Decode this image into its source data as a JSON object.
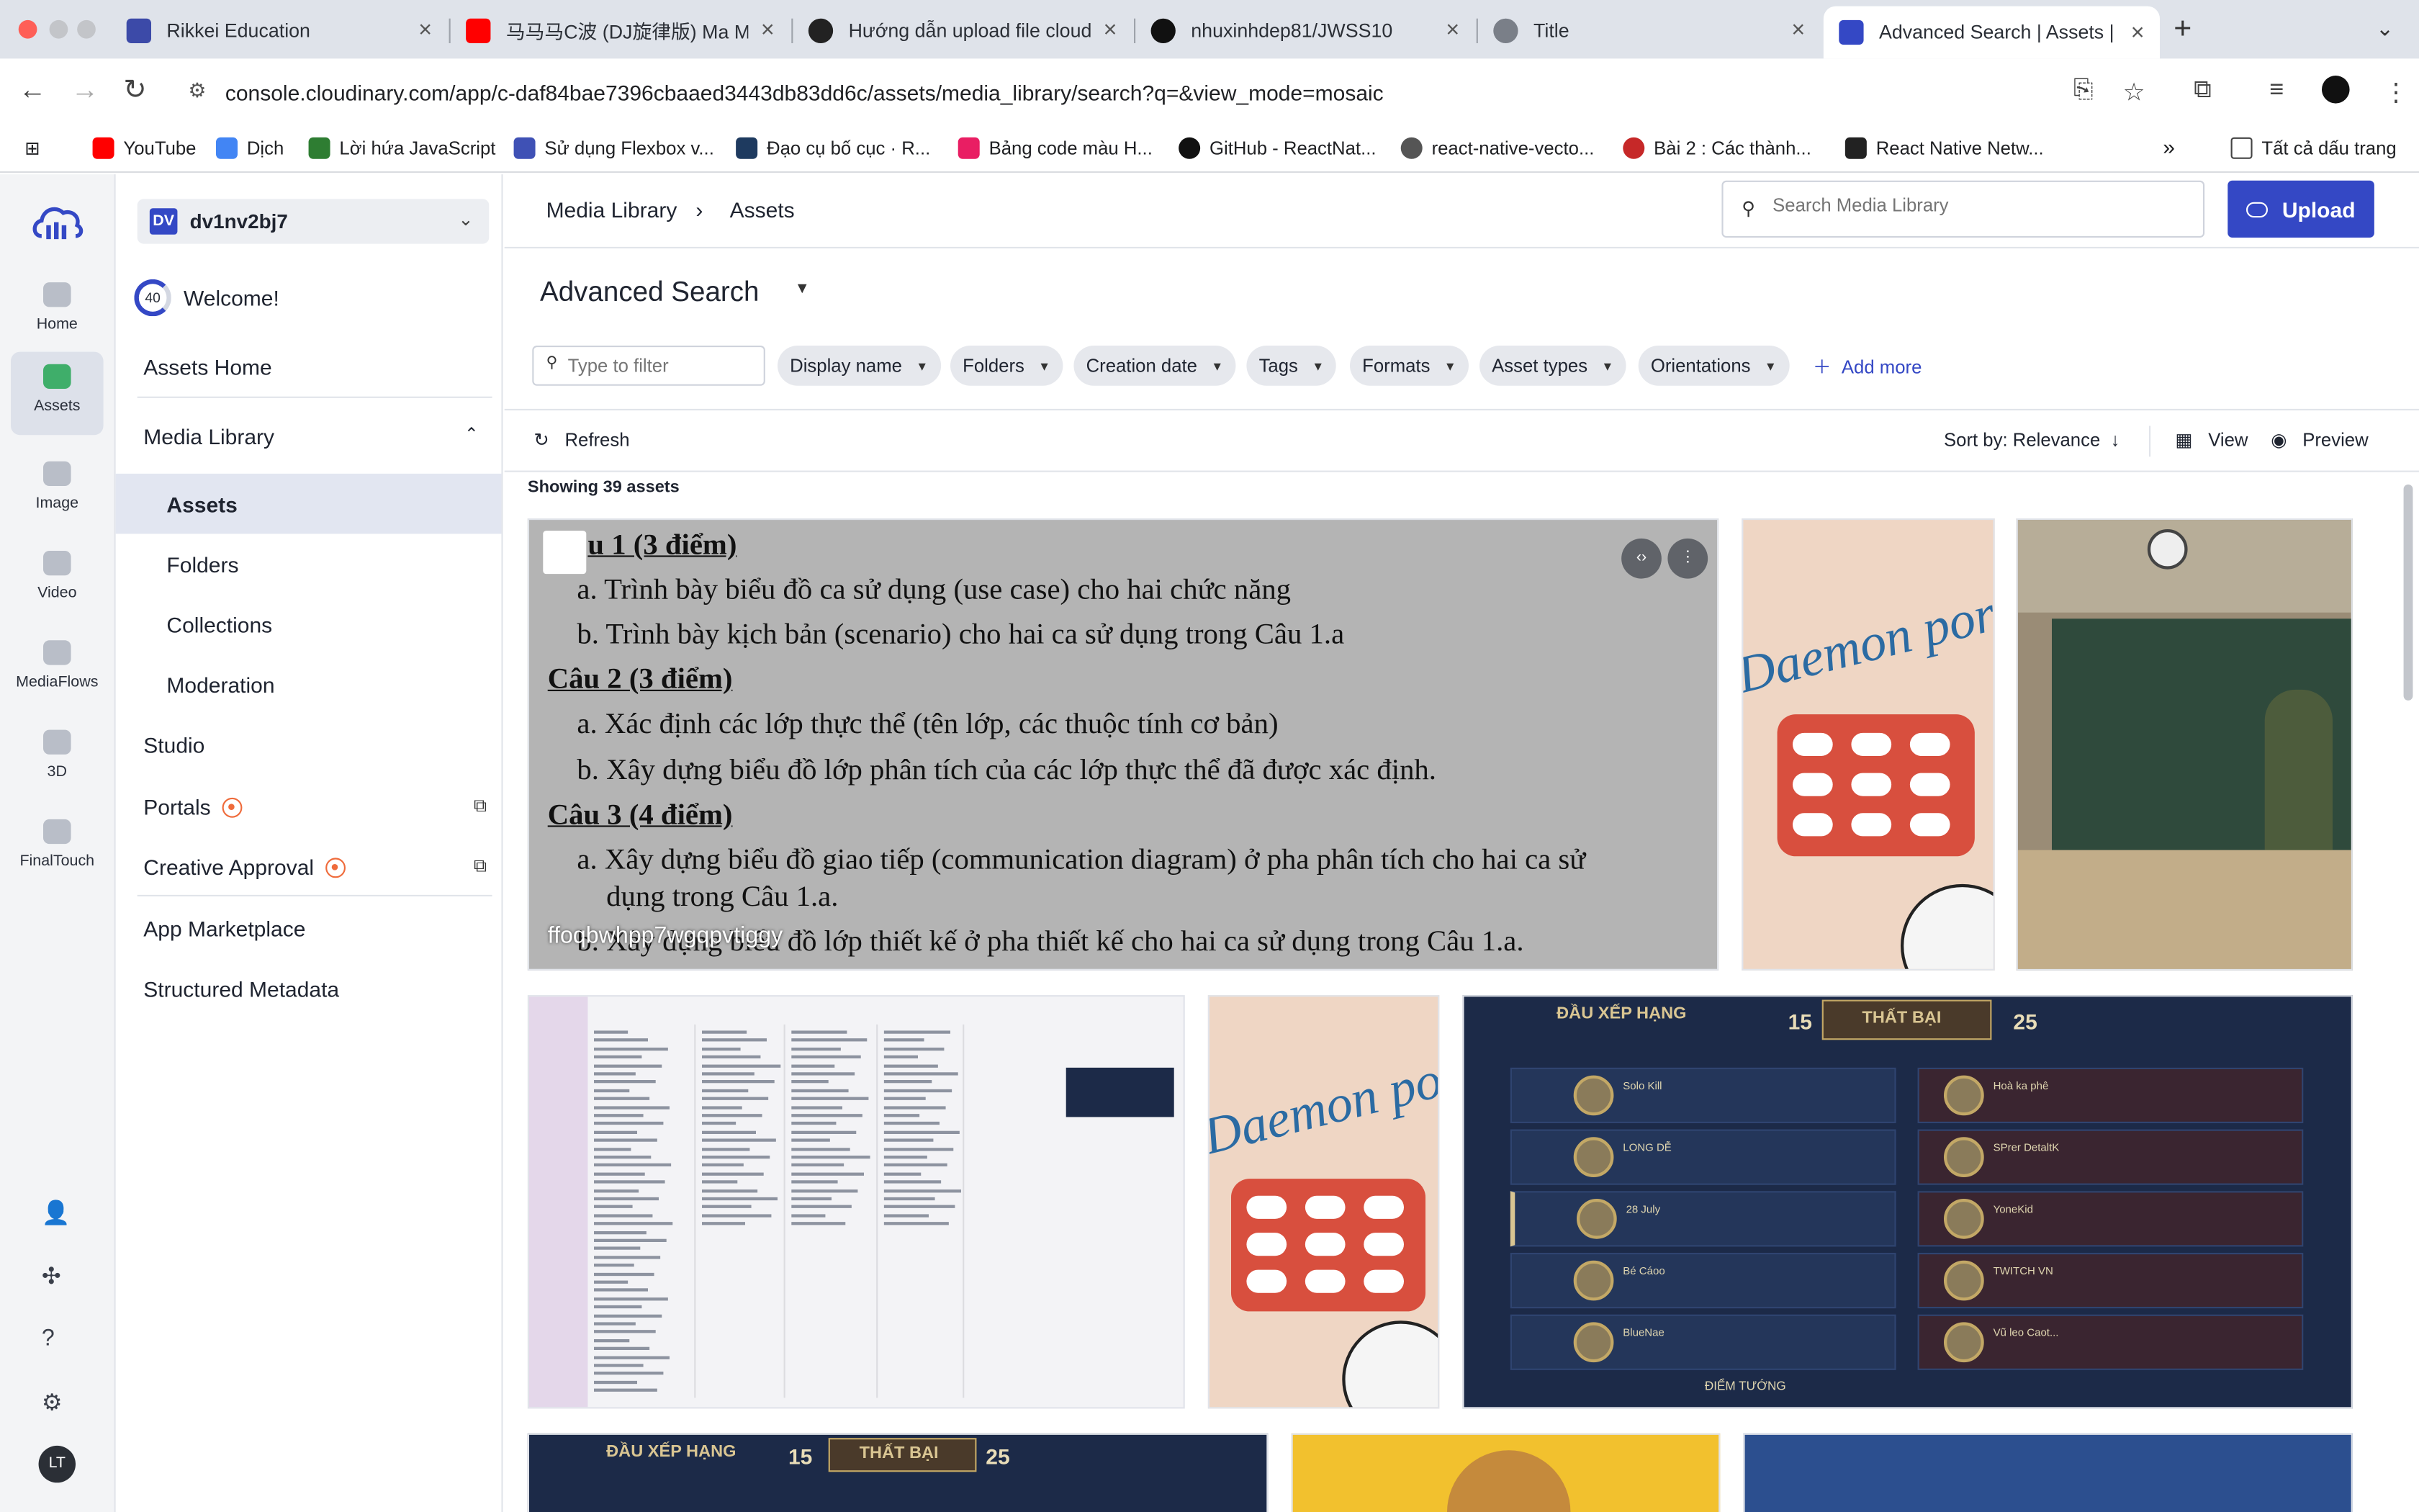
{
  "browser": {
    "tabs": [
      {
        "label": "Rikkei Education",
        "color": "#3c4aa8"
      },
      {
        "label": "马马马C波 (DJ旋律版) Ma Ma C",
        "color": "#ff0000"
      },
      {
        "label": "Hướng dẫn upload file cloud",
        "color": "#222222"
      },
      {
        "label": "nhuxinhdep81/JWSS10",
        "color": "#111111"
      },
      {
        "label": "Title",
        "color": "#7a7f88"
      },
      {
        "label": "Advanced Search | Assets | A",
        "color": "#3448c5"
      }
    ],
    "url": "console.cloudinary.com/app/c-daf84bae7396cbaaed3443db83dd6c/assets/media_library/search?q=&view_mode=mosaic",
    "bookmarks": [
      {
        "label": "YouTube",
        "color": "#ff0000"
      },
      {
        "label": "Dịch",
        "color": "#4285f4"
      },
      {
        "label": "Lời hứa JavaScript",
        "color": "#2e7d32"
      },
      {
        "label": "Sử dụng Flexbox v...",
        "color": "#3f51b5"
      },
      {
        "label": "Đạo cụ bố cục · R...",
        "color": "#1e3a5f"
      },
      {
        "label": "Bảng code màu H...",
        "color": "#e91e63"
      },
      {
        "label": "GitHub - ReactNat...",
        "color": "#111111"
      },
      {
        "label": "react-native-vecto...",
        "color": "#555555"
      },
      {
        "label": "Bài 2 : Các thành...",
        "color": "#c62828"
      },
      {
        "label": "React Native Netw...",
        "color": "#222222"
      }
    ],
    "all_bookmarks": "Tất cả dấu trang"
  },
  "rail": {
    "items": [
      "Home",
      "Assets",
      "Image",
      "Video",
      "MediaFlows",
      "3D",
      "FinalTouch"
    ],
    "avatar": "LT"
  },
  "nav": {
    "cloud_badge": "DV",
    "cloud_name": "dv1nv2bj7",
    "progress": "40",
    "welcome": "Welcome!",
    "assets_home": "Assets Home",
    "media_library": "Media Library",
    "sub": [
      "Assets",
      "Folders",
      "Collections",
      "Moderation"
    ],
    "studio": "Studio",
    "portals": "Portals",
    "creative_approval": "Creative Approval",
    "app_marketplace": "App Marketplace",
    "structured_metadata": "Structured Metadata"
  },
  "header": {
    "breadcrumb": [
      "Media Library",
      "Assets"
    ],
    "search_placeholder": "Search Media Library",
    "upload": "Upload"
  },
  "advanced": {
    "title": "Advanced Search",
    "filter_placeholder": "Type to filter",
    "chips": [
      "Display name",
      "Folders",
      "Creation date",
      "Tags",
      "Formats",
      "Asset types",
      "Orientations"
    ],
    "add_more": "Add more"
  },
  "toolbar": {
    "refresh": "Refresh",
    "sort": "Sort by: Relevance",
    "view": "View",
    "preview": "Preview",
    "showing": "Showing 39 assets"
  },
  "assets": {
    "doc": {
      "lines": [
        "u 1 (3 điểm)",
        "a. Trình bày biểu đồ ca sử dụng (use case) cho hai chức năng",
        "b. Trình bày kịch bản (scenario) cho hai ca sử dụng trong Câu 1.a",
        "Câu 2 (3 điểm)",
        "a. Xác định các lớp thực thể (tên lớp, các thuộc tính cơ bản)",
        "b. Xây dựng biểu đồ lớp phân tích của các lớp thực thể đã được xác định.",
        "Câu 3 (4 điểm)",
        "a. Xây dựng biểu đồ giao tiếp (communication diagram) ở pha phân tích cho hai ca sử",
        "dụng trong Câu 1.a.",
        "b. Xây dựng biểu đồ lớp thiết kế ở pha thiết kế cho hai ca sử dụng trong Câu 1.a."
      ],
      "name": "ffoqbwhpp7wgqpvtiggy"
    },
    "pill_text": "Daemon ports",
    "game": {
      "title": "ĐẦU XẾP HẠNG",
      "result": "THẤT BẠI",
      "left_score": "15",
      "right_score": "25",
      "left_players": [
        "Solo Kill",
        "LONG DỄ",
        "28 July",
        "Bé Cáoo",
        "BlueNae"
      ],
      "right_players": [
        "Hoà ka phê",
        "SPrer DetaltK",
        "YoneKid",
        "TWITCH VN",
        "Vũ leo Caot..."
      ],
      "footer": "ĐIỂM TƯỚNG"
    }
  }
}
